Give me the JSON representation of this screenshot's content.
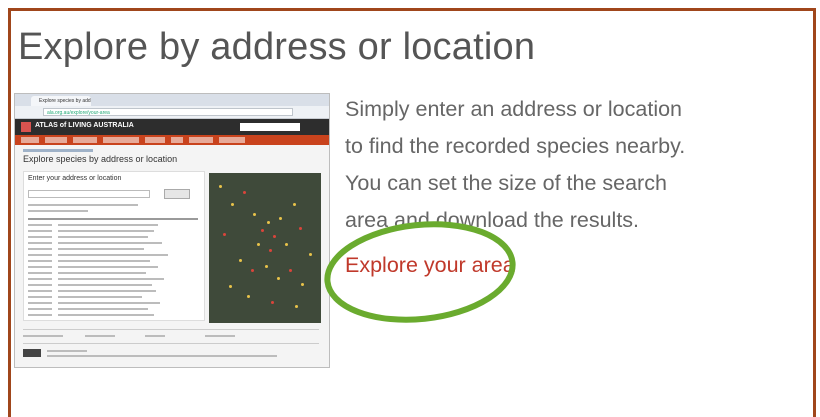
{
  "heading": "Explore by address or location",
  "description_lines": [
    "Simply enter an address or location",
    "to find the recorded species nearby.",
    "You can set the size of the search",
    "area and download the results."
  ],
  "link_label": "Explore your area",
  "screenshot": {
    "tab_label": "Explore species by address o",
    "url_text": "ala.org.au/explore/your-area",
    "logo_text": "ATLAS of LIVING AUSTRALIA",
    "page_heading": "Explore species by address or location",
    "panel_heading": "Enter your address or location"
  },
  "colors": {
    "border": "#a0461b",
    "heading_text": "#555555",
    "body_text": "#666666",
    "link": "#c0392b",
    "highlight_ring": "#6aab2e",
    "nav_bar": "#c9431d"
  }
}
